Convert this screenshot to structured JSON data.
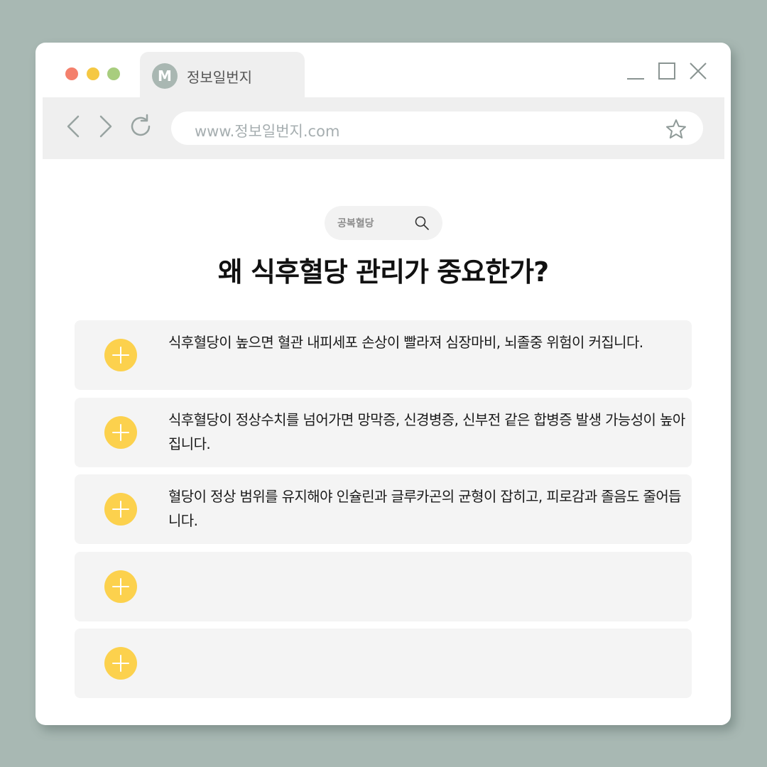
{
  "window": {
    "tab_icon_letter": "M",
    "tab_title": "정보일번지"
  },
  "toolbar": {
    "url": "www.정보일번지.com"
  },
  "content": {
    "search_chip": "공복혈당",
    "heading": "왜 식후혈당 관리가 중요한가?",
    "cards": [
      {
        "text": "식후혈당이 높으면 혈관 내피세포 손상이 빨라져 심장마비, 뇌졸중 위험이 커집니다."
      },
      {
        "text": "식후혈당이 정상수치를 넘어가면 망막증, 신경병증, 신부전 같은 합병증 발생 가능성이 높아집니다."
      },
      {
        "text": "혈당이 정상 범위를 유지해야 인슐린과 글루카곤의 균형이 잡히고, 피로감과 졸음도 줄어듭니다."
      },
      {
        "text": ""
      },
      {
        "text": ""
      }
    ]
  },
  "colors": {
    "background": "#a8b8b3",
    "accent_plus": "#fcd14d",
    "dot_red": "#f4806c",
    "dot_yellow": "#f5c843",
    "dot_green": "#a8cd7e"
  },
  "icons": [
    "close-icon",
    "minimize-icon",
    "maximize-icon",
    "back-arrow-icon",
    "forward-arrow-icon",
    "reload-icon",
    "star-icon",
    "search-icon",
    "plus-icon"
  ]
}
